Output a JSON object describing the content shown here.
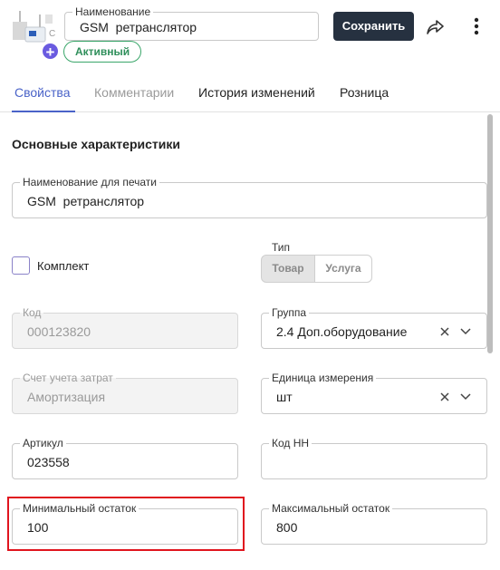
{
  "header": {
    "name_label": "Наименование",
    "name_value": "GSM  ретранслятор",
    "status": "Активный",
    "save_label": "Сохранить",
    "add_symbol": "+"
  },
  "tabs": [
    {
      "label": "Свойства",
      "state": "active"
    },
    {
      "label": "Комментарии",
      "state": "muted"
    },
    {
      "label": "История изменений",
      "state": "normal"
    },
    {
      "label": "Розница",
      "state": "normal"
    }
  ],
  "section": {
    "title": "Основные характеристики"
  },
  "form": {
    "print_name": {
      "label": "Наименование для печати",
      "value": "GSM  ретранслятор"
    },
    "kit": {
      "label": "Комплект",
      "checked": false
    },
    "type": {
      "label": "Тип",
      "options": [
        "Товар",
        "Услуга"
      ],
      "selected": "Товар"
    },
    "code": {
      "label": "Код",
      "value": "000123820"
    },
    "group": {
      "label": "Группа",
      "value": "2.4 Доп.оборудование"
    },
    "cost_account": {
      "label": "Счет учета затрат",
      "value": "Амортизация"
    },
    "unit": {
      "label": "Единица измерения",
      "value": "шт"
    },
    "article": {
      "label": "Артикул",
      "value": "023558"
    },
    "code_nn": {
      "label": "Код НН",
      "value": ""
    },
    "min_stock": {
      "label": "Минимальный остаток",
      "value": "100"
    },
    "max_stock": {
      "label": "Максимальный остаток",
      "value": "800"
    }
  },
  "icons": {
    "share": "share-icon",
    "more": "more-vertical-icon",
    "clear": "close-icon",
    "dropdown": "chevron-down-icon"
  },
  "colors": {
    "accent": "#4a63c8",
    "save_button": "#263140",
    "status_green": "#2f8f5b",
    "add_button": "#6a5be0",
    "highlight": "#e0141e"
  }
}
